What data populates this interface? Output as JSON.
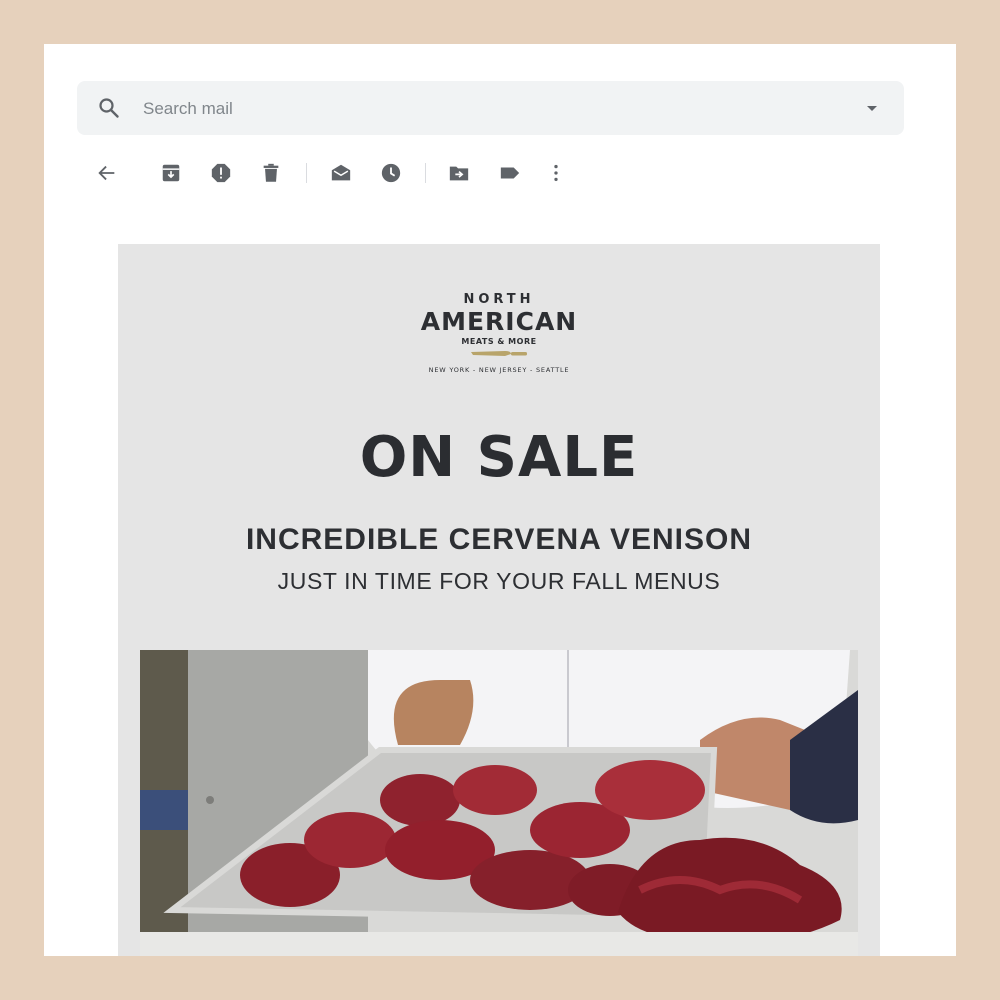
{
  "search": {
    "placeholder": "Search mail",
    "search_icon": "search-icon",
    "dropdown_icon": "caret-down-icon"
  },
  "toolbar": {
    "buttons": [
      {
        "name": "back-button",
        "icon": "arrow-left-icon"
      },
      {
        "name": "archive-button",
        "icon": "archive-icon"
      },
      {
        "name": "report-spam-button",
        "icon": "report-spam-icon"
      },
      {
        "name": "delete-button",
        "icon": "trash-icon"
      },
      {
        "name": "mark-unread-button",
        "icon": "mark-unread-icon"
      },
      {
        "name": "snooze-button",
        "icon": "clock-icon"
      },
      {
        "name": "move-to-button",
        "icon": "move-to-folder-icon"
      },
      {
        "name": "labels-button",
        "icon": "label-icon"
      },
      {
        "name": "more-button",
        "icon": "more-vert-icon"
      }
    ]
  },
  "email": {
    "logo": {
      "line1": "NORTH",
      "line2": "AMERICAN",
      "line3": "MEATS & MORE",
      "cities": "NEW YORK - NEW JERSEY - SEATTLE",
      "knife_color": "#b8a46a"
    },
    "headline": "ON SALE",
    "subheadline": "INCREDIBLE CERVENA VENISON",
    "tagline": "JUST IN TIME FOR YOUR FALL MENUS",
    "hero_image": "chef-holding-tray-of-raw-venison-cuts"
  },
  "colors": {
    "frame": "#e6d1bc",
    "search_bg": "#f1f3f4",
    "email_bg": "#e5e5e5",
    "text_dark": "#2d2f33",
    "icon_gray": "#5f6368"
  }
}
